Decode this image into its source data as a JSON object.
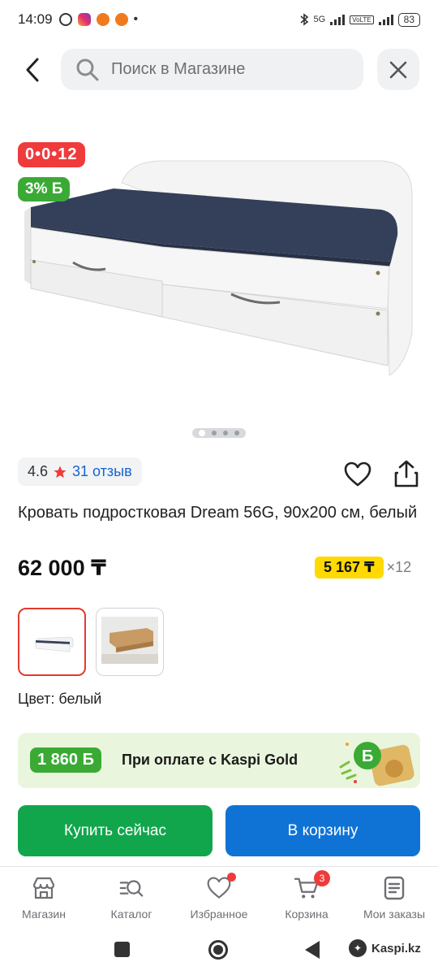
{
  "status_bar": {
    "time": "14:09",
    "network": "5G",
    "volte": "VoLTE",
    "battery": "83"
  },
  "header": {
    "search_placeholder": "Поиск в Магазине",
    "back_icon": "chevron-left-icon",
    "close_icon": "close-icon",
    "search_icon": "search-icon"
  },
  "product": {
    "badge_timer": "0•0•12",
    "badge_bonus": "3% Б",
    "gallery_pages": 4,
    "gallery_active_index": 0,
    "rating": "4.6",
    "reviews": "31 отзыв",
    "title": "Кровать подростковая Dream 56G, 90x200 см, белый",
    "price": "62 000 ₸",
    "installment_amount": "5 167 ₸",
    "installment_term": "×12",
    "color_label": "Цвет: белый",
    "thumbnails": [
      "white bed",
      "wooden bed"
    ]
  },
  "kaspi_gold": {
    "bonus": "1 860 Б",
    "text": "При оплате с Kaspi Gold"
  },
  "actions": {
    "buy_now": "Купить сейчас",
    "add_to_cart": "В корзину"
  },
  "bottom_nav": {
    "items": [
      {
        "label": "Магазин",
        "icon": "store-icon"
      },
      {
        "label": "Каталог",
        "icon": "catalog-search-icon"
      },
      {
        "label": "Избранное",
        "icon": "heart-icon"
      },
      {
        "label": "Корзина",
        "icon": "cart-icon",
        "badge": "3"
      },
      {
        "label": "Мои заказы",
        "icon": "orders-icon"
      }
    ]
  },
  "system_nav": {
    "watermark": "Kaspi.kz"
  },
  "colors": {
    "accent_red": "#ef3b3b",
    "bonus_green": "#3aaa35",
    "buy_green": "#12a64c",
    "cart_blue": "#0f73d6",
    "installment_yellow": "#ffd900",
    "link_blue": "#1664d0"
  }
}
